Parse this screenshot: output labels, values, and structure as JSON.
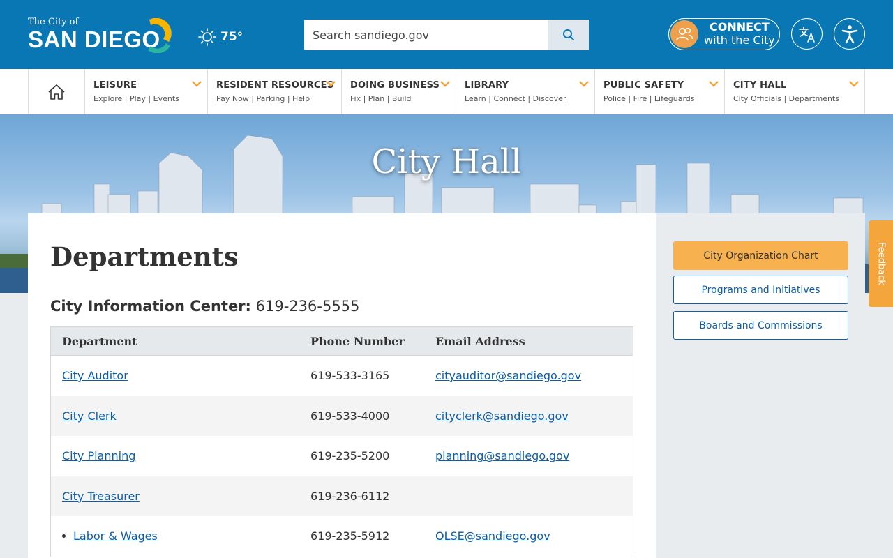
{
  "header": {
    "logo_small": "The City of",
    "logo_big": "SAN DIEGO",
    "weather_temp": "75°",
    "search_placeholder": "Search sandiego.gov",
    "connect_line1": "CONNECT",
    "connect_line2": "with the City"
  },
  "nav": {
    "items": [
      {
        "title": "LEISURE",
        "sub": "Explore | Play | Events"
      },
      {
        "title": "RESIDENT RESOURCES",
        "sub": "Pay Now | Parking | Help"
      },
      {
        "title": "DOING BUSINESS",
        "sub": "Fix | Plan | Build"
      },
      {
        "title": "LIBRARY",
        "sub": "Learn | Connect | Discover"
      },
      {
        "title": "PUBLIC SAFETY",
        "sub": "Police | Fire | Lifeguards"
      },
      {
        "title": "CITY HALL",
        "sub": "City Officials | Departments"
      }
    ]
  },
  "hero": {
    "title": "City Hall"
  },
  "main": {
    "title": "Departments",
    "info_label": "City Information Center:",
    "info_phone": "619-236-5555",
    "table": {
      "headers": [
        "Department",
        "Phone Number",
        "Email Address"
      ],
      "rows": [
        {
          "dept": "City Auditor",
          "phone": "619-533-3165",
          "email": "cityauditor@sandiego.gov"
        },
        {
          "dept": "City Clerk",
          "phone": "619-533-4000",
          "email": "cityclerk@sandiego.gov"
        },
        {
          "dept": "City Planning",
          "phone": "619-235-5200",
          "email": "planning@sandiego.gov"
        },
        {
          "dept": "City Treasurer",
          "phone": "619-236-6112",
          "email": ""
        },
        {
          "dept": "Labor & Wages",
          "phone": "619-235-5912",
          "email": "OLSE@sandiego.gov"
        }
      ]
    }
  },
  "sidebar": {
    "buttons": [
      "City Organization Chart",
      "Programs and Initiatives",
      "Boards and Commissions"
    ]
  },
  "feedback_label": "Feedback",
  "colors": {
    "header_blue": "#0a77b5",
    "accent_orange": "#f7b24f",
    "link_blue": "#0b5ea8"
  }
}
